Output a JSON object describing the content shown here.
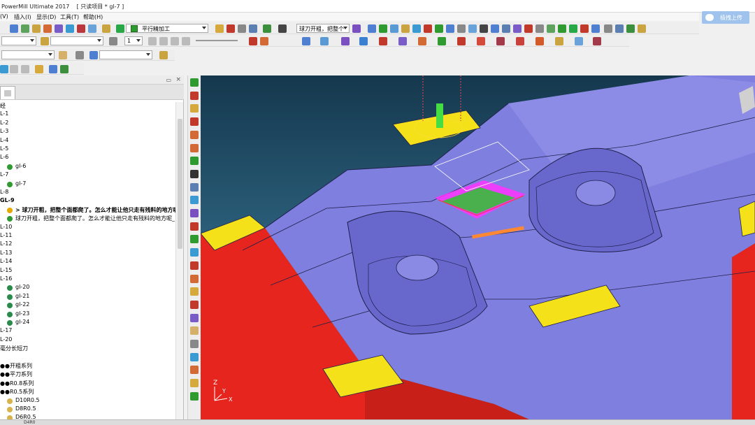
{
  "window": {
    "title": "PowerMill Ultimate 2017    [ 只读项目 * gl-7 ]",
    "upload_label": "极拽上传"
  },
  "menu": {
    "items": [
      "(V)",
      "插入(I)",
      "显示(D)",
      "工具(T)",
      "帮助(H)"
    ]
  },
  "toolbar": {
    "strategy_combo": "平行精加工",
    "toolpath_combo": "球刀开粗，把整个",
    "step_value": "1"
  },
  "explorer": {
    "rows": [
      {
        "text": "经"
      },
      {
        "text": "L-1"
      },
      {
        "text": "L-2"
      },
      {
        "text": "L-3"
      },
      {
        "text": "L-4"
      },
      {
        "text": "L-5"
      },
      {
        "text": "L-6"
      },
      {
        "text": "gl-6",
        "icon": "toolpath"
      },
      {
        "text": "L-7"
      },
      {
        "text": "gl-7",
        "icon": "toolpath"
      },
      {
        "text": "L-8"
      },
      {
        "text": "GL-9",
        "bold": true
      },
      {
        "text": "> 球刀开粗，把整个面都爬了。怎么才能让他只走有残料的地方呢",
        "icon": "active",
        "bold": true
      },
      {
        "text": "球刀开粗，把整个面都爬了。怎么才能让他只走有残料的地方呢_1",
        "icon": "toolpath"
      },
      {
        "text": "L-10"
      },
      {
        "text": "L-11"
      },
      {
        "text": "L-12"
      },
      {
        "text": "L-13"
      },
      {
        "text": "L-14"
      },
      {
        "text": "L-15"
      },
      {
        "text": "L-16"
      },
      {
        "text": "gl-20",
        "icon": "stack"
      },
      {
        "text": "gl-21",
        "icon": "stack"
      },
      {
        "text": "gl-22",
        "icon": "stack"
      },
      {
        "text": "gl-23",
        "icon": "stack"
      },
      {
        "text": "gl-24",
        "icon": "stack"
      },
      {
        "text": "L-17"
      },
      {
        "text": "L-20"
      },
      {
        "text": "毫分长短刀"
      },
      {
        "text": ""
      },
      {
        "text": "●●开粗系列"
      },
      {
        "text": "●●平刀系列"
      },
      {
        "text": "●●R0.8系列"
      },
      {
        "text": "●●R0.5系列"
      },
      {
        "text": "D10R0.5",
        "icon": "tool"
      },
      {
        "text": "D8R0.5",
        "icon": "tool"
      },
      {
        "text": "D6R0.5",
        "icon": "tool"
      }
    ]
  },
  "statusbar": {
    "tool_field": "D4R0"
  },
  "viewport": {
    "axis_z": "Z",
    "axis_y": "Y",
    "axis_x": "X"
  },
  "colors": {
    "model_face": "#7f7fe0",
    "model_top": "#8c8ce6",
    "side_red": "#e6261e",
    "yellow": "#f5e11a",
    "toolpath_magenta": "#ff33ff",
    "toolpath_green": "#22cc22"
  }
}
